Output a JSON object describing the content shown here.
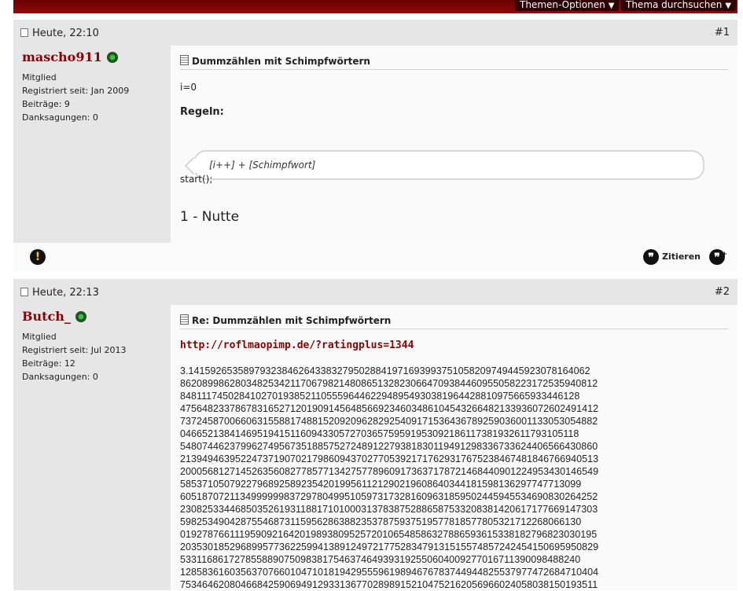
{
  "toolbar": {
    "thread_options": "Themen-Optionen",
    "search_thread": "Thema durchsuchen"
  },
  "posts": [
    {
      "date": "Heute, 22:10",
      "number": "#1",
      "user": {
        "name": "mascho911",
        "rank": "Mitglied",
        "registered": "Registriert seit: Jan 2009",
        "posts": "Beiträge: 9",
        "thanks": "Danksagungen: 0"
      },
      "title": "Dummzählen mit Schimpfwörtern",
      "line1": "i=0",
      "rules_heading": "Regeln:",
      "quote": "[i++] + [Schimpfwort]",
      "line_start": "start();",
      "big_line": "1 - Nutte",
      "quote_button": "Zitieren"
    },
    {
      "date": "Heute, 22:13",
      "number": "#2",
      "user": {
        "name": "Butch_",
        "rank": "Mitglied",
        "registered": "Registriert seit: Jul 2013",
        "posts": "Beiträge: 12",
        "thanks": "Danksagungen: 0"
      },
      "title": "Re: Dummzählen mit Schimpfwörtern",
      "link": "http://roflmaopimp.de/?ratingplus=1344",
      "pi_lines": [
        "3.1415926535897932384626433832795028841971693993751058209749445923078164062",
        "8620899862803482534211706798214808651328230664709384460955058223172535940812",
        "8481117450284102701938521105559644622948954930381964428810975665933446128",
        "4756482337867831652712019091456485669234603486104543266482133936072602491412",
        "7372458700660631558817488152092096282925409171536436789259036001133053054882",
        "0466521384146951941511609433057270365759591953092186117381932611793105118",
        "5480744623799627495673518857527248912279381830119491298336733624406566430860",
        "2139494639522473719070217986094370277053921717629317675238467481846766940513",
        "2000568127145263560827785771342757789609173637178721468440901224953430146549",
        "5853710507922796892589235420199561121290219608640344181598136297747713099",
        "6051870721134999999837297804995105973173281609631859502445945534690830264252",
        "2308253344685035261931188171010003137838752886587533208381420617177669147303",
        "5982534904287554687311595628638823537875937519577818577805321712268066130",
        "0192787661119590921642019893809525720106548586327886593615338182796823030195",
        "2035301852968995773622599413891249721775283479131515574857242454150695950829",
        "5331168617278558890750983817546374649393192550604009277016711390098488240",
        "1285836160356370766010471018194295559619894676783744944825537977472684710404",
        "7534646208046684259069491293313677028989152104752162056966024058038150193511"
      ]
    }
  ]
}
